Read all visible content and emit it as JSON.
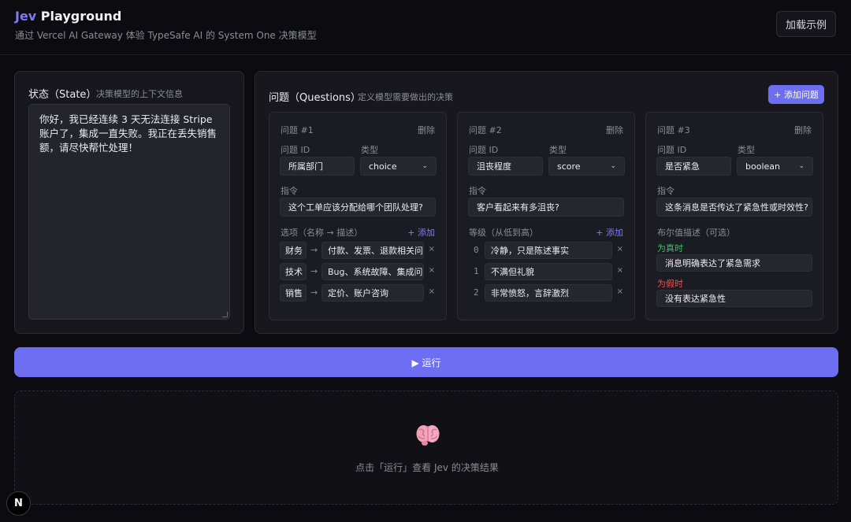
{
  "header": {
    "title_accent": "Jev",
    "title_rest": " Playground",
    "subtitle": "通过 Vercel AI Gateway 体验 TypeSafe AI 的 System One 决策模型",
    "load_example_label": "加载示例"
  },
  "state": {
    "title": "状态（State）",
    "desc": "决策模型的上下文信息",
    "text": "你好，我已经连续 3 天无法连接 Stripe 账户了，集成一直失败。我正在丢失销售额，请尽快帮忙处理！"
  },
  "questions": {
    "title": "问题（Questions）",
    "desc": "定义模型需要做出的决策",
    "add_label": "+ 添加问题",
    "id_label": "问题 ID",
    "type_label": "类型",
    "instruction_label": "指令",
    "delete_label": "删除",
    "add_link": "+ 添加",
    "cards": [
      {
        "num": "问题 #1",
        "id": "所属部门",
        "type": "choice",
        "instruction": "这个工单应该分配给哪个团队处理?",
        "section_label": "选项（名称 → 描述）",
        "options": [
          {
            "name": "财务",
            "desc": "付款、发票、退款相关问题"
          },
          {
            "name": "技术",
            "desc": "Bug、系统故障、集成问题"
          },
          {
            "name": "销售",
            "desc": "定价、账户咨询"
          }
        ]
      },
      {
        "num": "问题 #2",
        "id": "沮丧程度",
        "type": "score",
        "instruction": "客户看起来有多沮丧?",
        "section_label": "等级（从低到高）",
        "levels": [
          {
            "n": "0",
            "text": "冷静，只是陈述事实"
          },
          {
            "n": "1",
            "text": "不满但礼貌"
          },
          {
            "n": "2",
            "text": "非常愤怒，言辞激烈"
          }
        ]
      },
      {
        "num": "问题 #3",
        "id": "是否紧急",
        "type": "boolean",
        "instruction": "这条消息是否传达了紧急性或时效性?",
        "section_label": "布尔值描述（可选）",
        "true_label": "为真时",
        "true_text": "消息明确表达了紧急需求",
        "false_label": "为假时",
        "false_text": "没有表达紧急性"
      }
    ]
  },
  "run_label": "▶ 运行",
  "result": {
    "placeholder": "点击「运行」查看 Jev 的决策结果"
  },
  "badge": "N",
  "icons": [
    "chevron-down-icon",
    "arrow-right-icon",
    "close-icon",
    "brain-icon",
    "resize-grip-icon"
  ],
  "colors": {
    "accent": "#6e6ef2",
    "true": "#3ac46a",
    "false": "#ef5353"
  }
}
